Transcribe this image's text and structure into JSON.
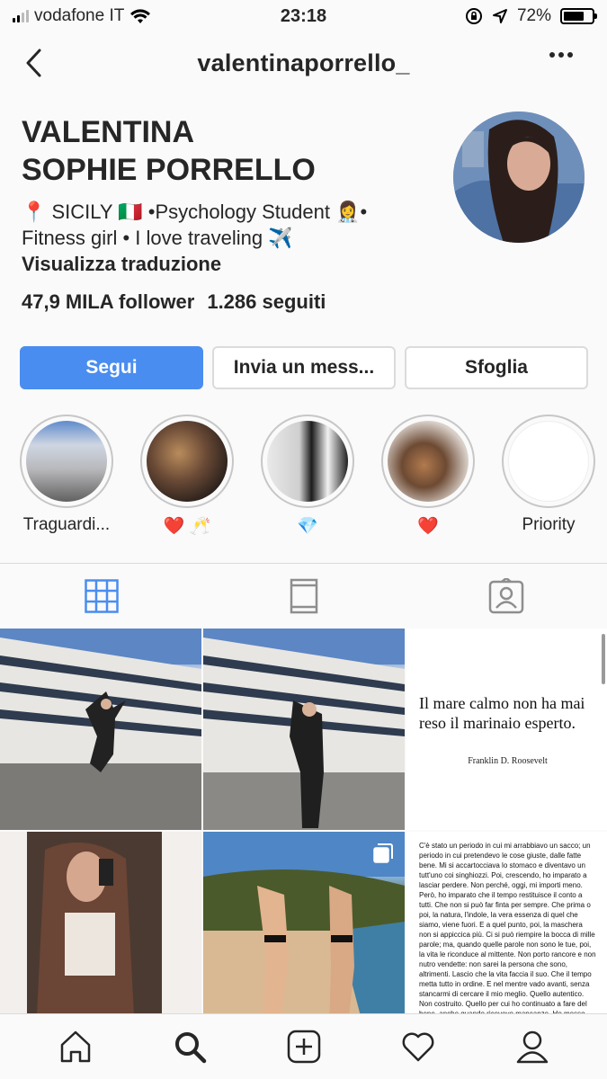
{
  "status_bar": {
    "carrier": "vodafone IT",
    "time": "23:18",
    "battery_percent": "72%",
    "battery_level": 0.72
  },
  "header": {
    "username": "valentinaporrello_"
  },
  "profile": {
    "name_line1": "VALENTINA",
    "name_line2": "SOPHIE PORRELLO",
    "bio_line1": "📍 SICILY 🇮🇹 •Psychology Student 👩‍⚕️•",
    "bio_line2": "Fitness girl • I love traveling ✈️",
    "translate_label": "Visualizza traduzione",
    "followers": "47,9 MILA follower",
    "following": "1.286 seguiti"
  },
  "actions": {
    "follow_label": "Segui",
    "message_label": "Invia un mess...",
    "browse_label": "Sfoglia"
  },
  "highlights": [
    {
      "label": "Traguardi..."
    },
    {
      "label": "❤️ 🥂"
    },
    {
      "label": "💎"
    },
    {
      "label": "❤️"
    },
    {
      "label": "Priority"
    }
  ],
  "posts": {
    "quote_text": "Il mare calmo non ha mai reso il marinaio esperto.",
    "quote_author": "Franklin D. Roosevelt",
    "long_text": "C'è stato un periodo in cui mi arrabbiavo un sacco; un periodo in cui pretendevo le cose giuste, dalle fatte bene. Mi si accartocciava lo stomaco e diventavo un tutt'uno coi singhiozzi. Poi, crescendo, ho imparato a lasciar perdere. Non perché, oggi, mi importi meno. Però, ho imparato che il tempo restituisce il conto a tutti. Che non si può far finta per sempre. Che prima o poi, la natura, l'indole, la vera essenza di quel che siamo, viene fuori. E a quel punto, poi, la maschera non si appiccica più. Ci si può riempire la bocca di mille parole; ma, quando quelle parole non sono le tue, poi, la vita le riconduce al mittente. Non porto rancore e non nutro vendette: non sarei la persona che sono, altrimenti. Lascio che la vita faccia il suo. Che il tempo metta tutto in ordine. E nel mentre vado avanti, senza stancarmi di cercare il mio meglio. Quello autentico. Non costruito. Quello per cui ho continuato a fare del bene, anche quando ricevevo mancanze. Ho messo sempre il cuore dalla parte giusta, e questo, prima o poi, la vita se lo ricorderà. Tutto arriva per chi sa aspettare."
  },
  "colors": {
    "accent": "#4a8df0",
    "text": "#262626",
    "border": "#dbdbdb"
  }
}
